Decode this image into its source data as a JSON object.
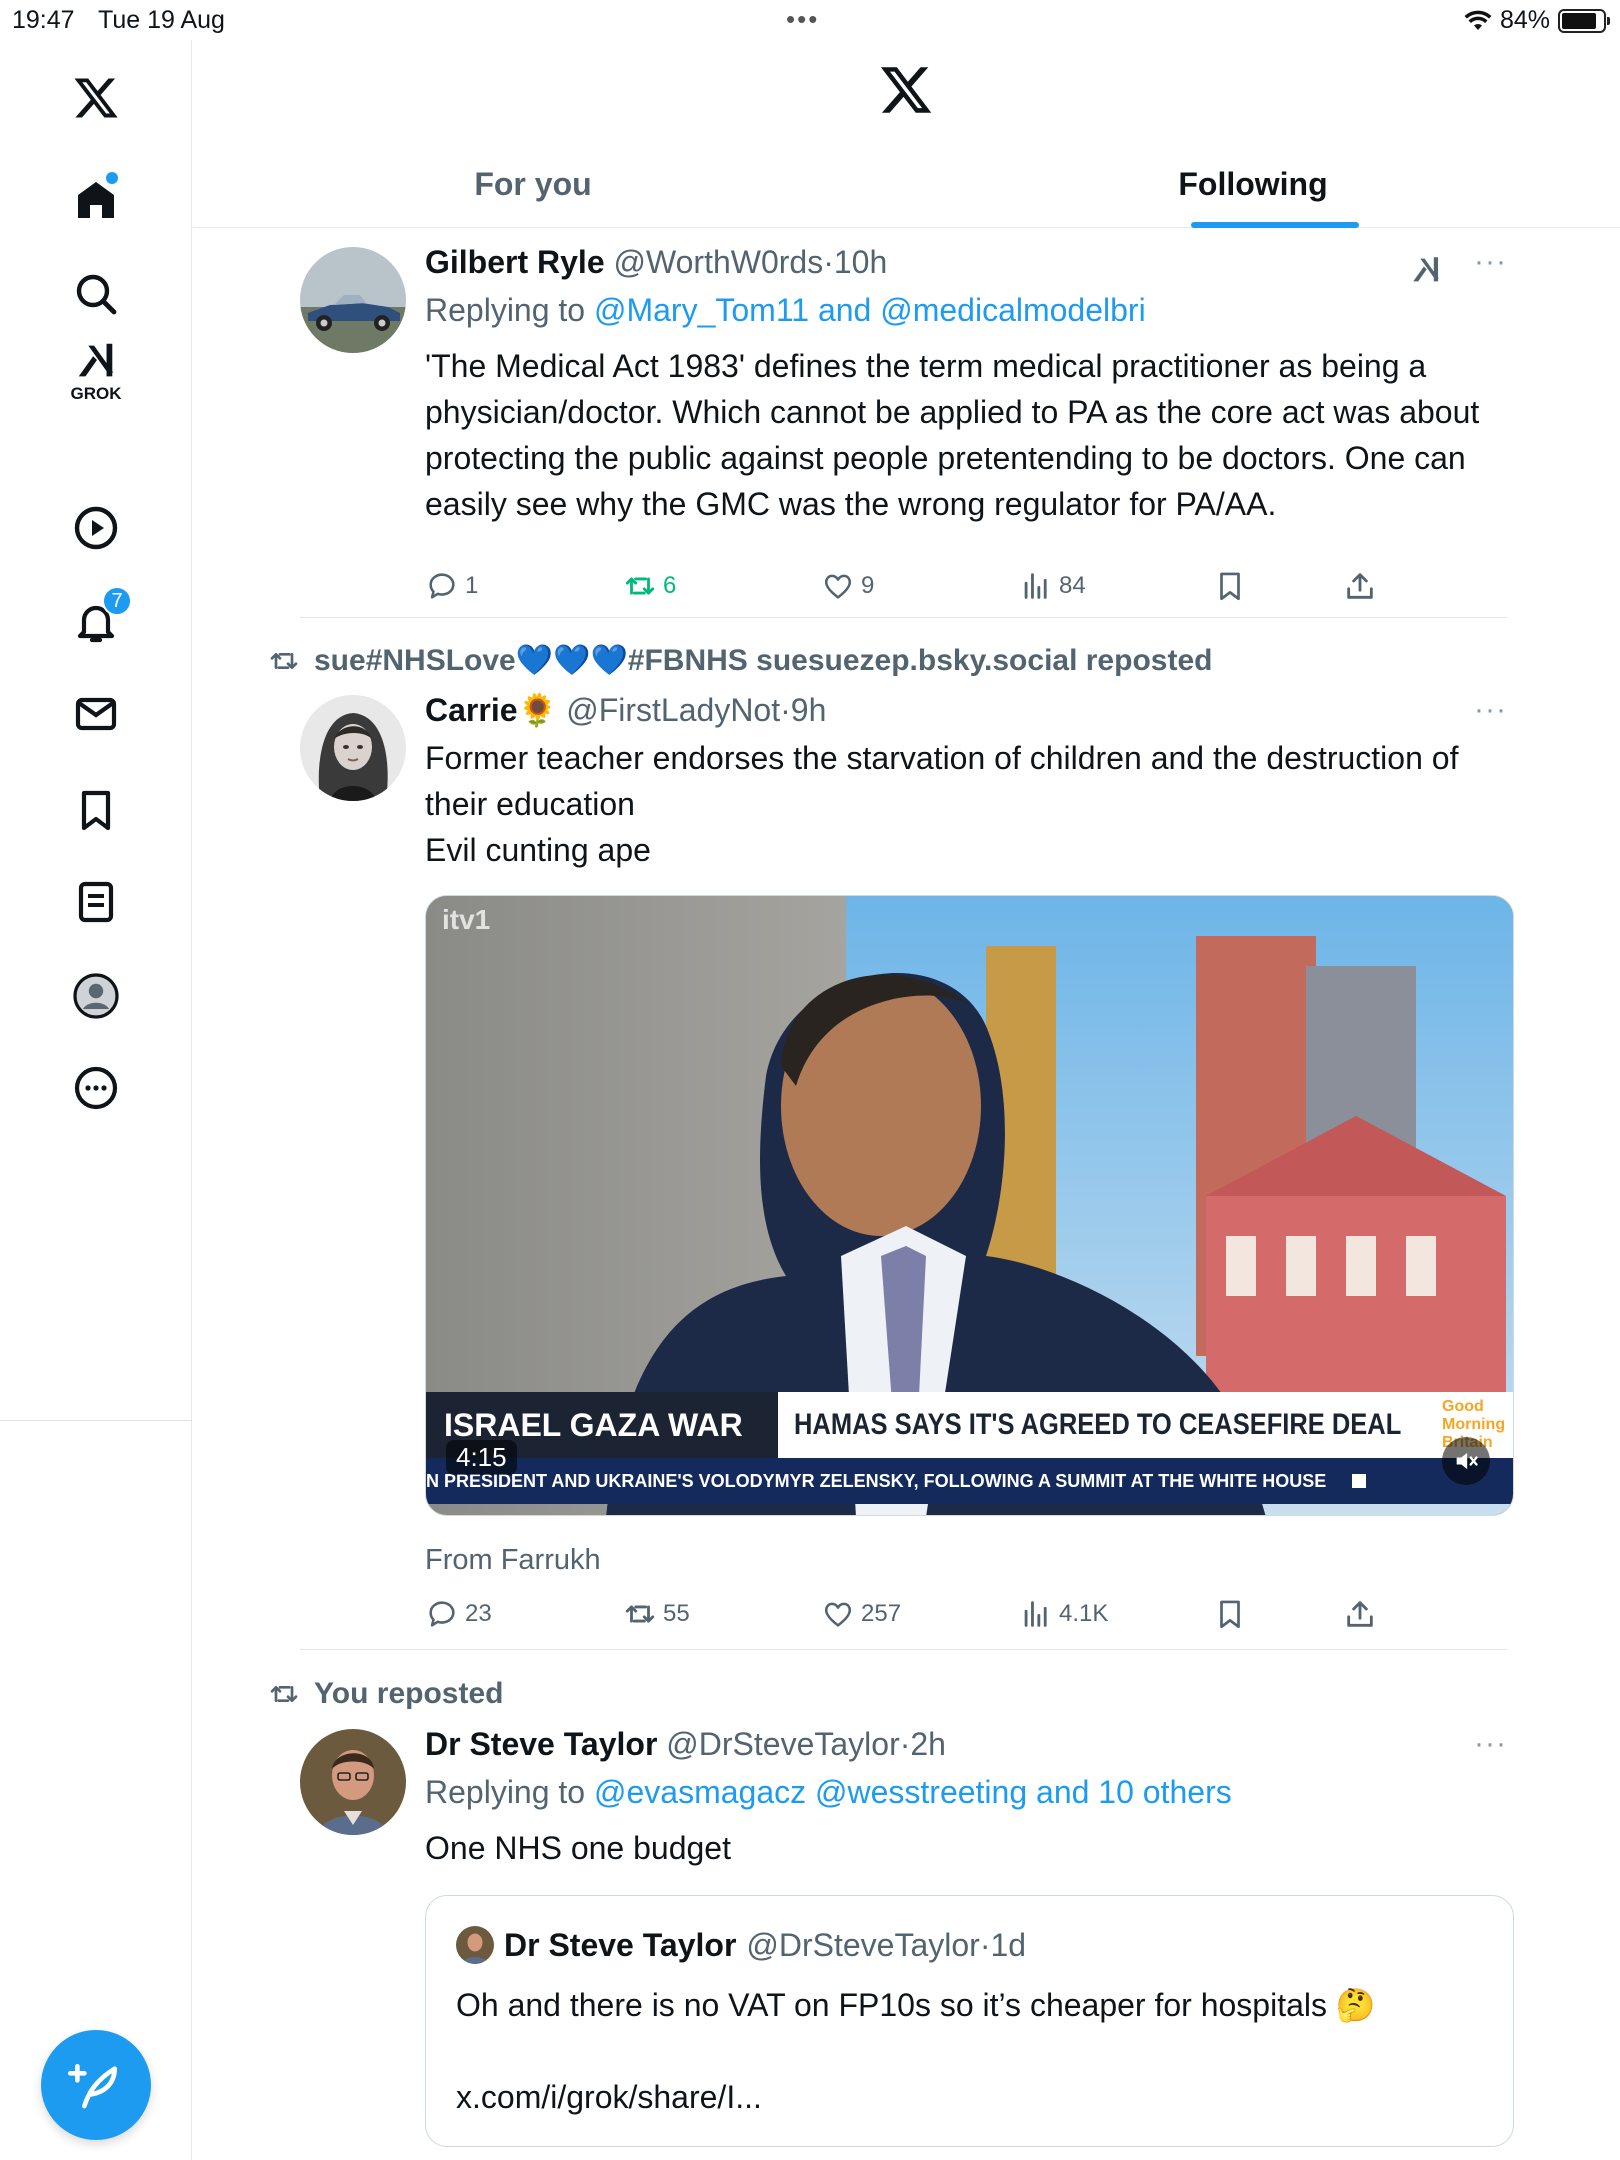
{
  "status_bar": {
    "time": "19:47",
    "date": "Tue 19 Aug",
    "battery": "84%",
    "battery_level": 0.84
  },
  "sidebar": {
    "grok_label": "GROK",
    "notifications_count": "7",
    "items": [
      {
        "name": "home",
        "icon": "home-icon"
      },
      {
        "name": "explore",
        "icon": "search-icon"
      },
      {
        "name": "grok",
        "icon": "grok-icon"
      },
      {
        "name": "video",
        "icon": "play-icon"
      },
      {
        "name": "notifications",
        "icon": "bell-icon"
      },
      {
        "name": "messages",
        "icon": "mail-icon"
      },
      {
        "name": "bookmarks",
        "icon": "bookmark-icon"
      },
      {
        "name": "lists",
        "icon": "list-icon"
      },
      {
        "name": "profile",
        "icon": "profile-icon"
      },
      {
        "name": "more",
        "icon": "more-icon"
      }
    ]
  },
  "tabs": {
    "for_you": "For you",
    "following": "Following",
    "active": "following"
  },
  "colors": {
    "accent": "#1d9bf0",
    "secondary_text": "#536471",
    "repost_active": "#00ba7c"
  },
  "posts": [
    {
      "name": "Gilbert Ryle",
      "handle": "@WorthW0rds",
      "sep": "·",
      "time": "10h",
      "reply_prefix": "Replying to",
      "reply_targets": "@Mary_Tom11 and @medicalmodelbri",
      "text": "'The Medical Act 1983' defines the term medical practitioner as being a physician/doctor. Which cannot be applied to PA as the core act was about protecting the public against people pretentending to be doctors. One can easily see why the GMC was the wrong regulator for PA/AA.",
      "replies": "1",
      "reposts": "6",
      "likes": "9",
      "views": "84"
    },
    {
      "social_context": "sue#NHSLove💙💙💙#FBNHS suesuezep.bsky.social reposted",
      "name": "Carrie",
      "name_emoji": "🌻",
      "handle": "@FirstLadyNot",
      "sep": "·",
      "time": "9h",
      "text_line1": "Former teacher endorses the starvation of children and the destruction of their education",
      "text_line2": "Evil cunting ape",
      "video": {
        "channel": "itv1",
        "lower_third_left": "ISRAEL GAZA WAR",
        "lower_third_right": "HAMAS SAYS IT'S AGREED TO CEASEFIRE DEAL",
        "ticker": "N PRESIDENT AND UKRAINE'S VOLODYMYR ZELENSKY, FOLLOWING A SUMMIT AT THE WHITE HOUSE",
        "show_logo": "Good Morning Britain",
        "duration": "4:15"
      },
      "attribution": "From Farrukh",
      "replies": "23",
      "reposts": "55",
      "likes": "257",
      "views": "4.1K"
    },
    {
      "social_context": "You reposted",
      "name": "Dr Steve Taylor",
      "handle": "@DrSteveTaylor",
      "sep": "·",
      "time": "2h",
      "reply_prefix": "Replying to",
      "reply_targets": "@evasmagacz @wesstreeting and 10 others",
      "text": "One NHS one budget",
      "quote": {
        "name": "Dr Steve Taylor",
        "handle": "@DrSteveTaylor",
        "sep": "·",
        "time": "1d",
        "text": "Oh and there is no VAT on FP10s so it’s cheaper for hospitals 🤔",
        "link": "x.com/i/grok/share/I..."
      }
    }
  ]
}
